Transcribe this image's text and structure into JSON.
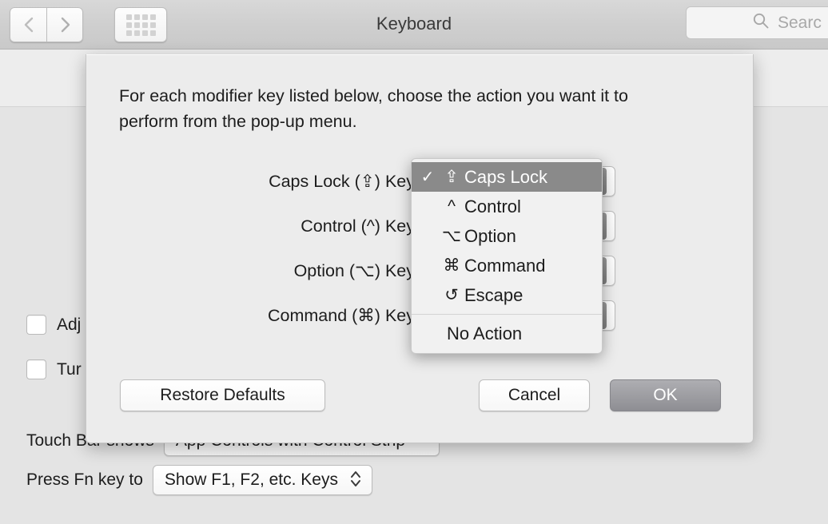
{
  "toolbar": {
    "back_icon": "chevron-left-icon",
    "forward_icon": "chevron-right-icon",
    "showall_icon": "grid-icon",
    "title": "Keyboard",
    "search": {
      "icon": "search-icon",
      "placeholder": "Searc"
    }
  },
  "pane": {
    "checkboxes": [
      {
        "label": "Adj",
        "checked": false
      },
      {
        "label": "Tur",
        "checked": false
      }
    ],
    "popups": [
      {
        "label": "Touch Bar shows",
        "value": "App Controls with Control Strip",
        "icon": "chevron-down-icon"
      },
      {
        "label": "Press Fn key to",
        "value": "Show F1, F2, etc. Keys",
        "icon": "updown-stepper-icon"
      }
    ]
  },
  "sheet": {
    "description": "For each modifier key listed below, choose the action you want it to perform from the pop-up menu.",
    "rows": [
      {
        "label": "Caps Lock (⇪) Key"
      },
      {
        "label": "Control (^) Key"
      },
      {
        "label": "Option (⌥) Key"
      },
      {
        "label": "Command (⌘) Key"
      }
    ],
    "buttons": {
      "restore": "Restore Defaults",
      "cancel": "Cancel",
      "ok": "OK"
    }
  },
  "menu": {
    "check_glyph": "✓",
    "items": [
      {
        "symbol": "⇪",
        "label": "Caps Lock",
        "selected": true
      },
      {
        "symbol": "^",
        "label": "Control",
        "selected": false
      },
      {
        "symbol": "⌥",
        "label": "Option",
        "selected": false
      },
      {
        "symbol": "⌘",
        "label": "Command",
        "selected": false
      },
      {
        "symbol": "↺",
        "label": "Escape",
        "selected": false
      }
    ],
    "no_action": "No Action"
  },
  "colors": {
    "highlight": "#8a8a8a",
    "sheet_bg": "#ececec",
    "toolbar_bg": "#cfcfcf",
    "default_button": "#8e8e93"
  }
}
